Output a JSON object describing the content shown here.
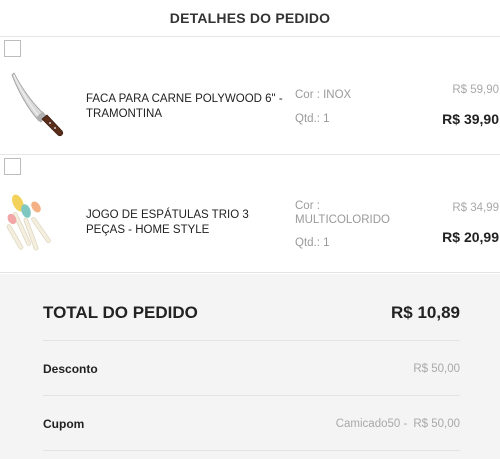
{
  "header": {
    "title": "DETALHES DO PEDIDO"
  },
  "items": [
    {
      "name": "FACA PARA CARNE POLYWOOD 6\" - TRAMONTINA",
      "color_label": "Cor : INOX",
      "qty_label": "Qtd.: 1",
      "old_price": "R$ 59,90",
      "price": "R$ 39,90",
      "image_icon": "knife-icon"
    },
    {
      "name": "JOGO DE ESPÁTULAS TRIO 3 PEÇAS - HOME STYLE",
      "color_label": "Cor : MULTICOLORIDO",
      "qty_label": "Qtd.: 1",
      "old_price": "R$ 34,99",
      "price": "R$ 20,99",
      "image_icon": "spatulas-icon"
    }
  ],
  "summary": {
    "total_label": "TOTAL DO PEDIDO",
    "total_value": "R$ 10,89",
    "discount_label": "Desconto",
    "discount_value": "R$ 50,00",
    "coupon_label": "Cupom",
    "coupon_code": "Camicado50 -",
    "coupon_value": "R$ 50,00"
  },
  "colors": {
    "summary_bg": "#f4f4f4",
    "muted_text": "#a9a9a9",
    "primary_text": "#222222"
  }
}
